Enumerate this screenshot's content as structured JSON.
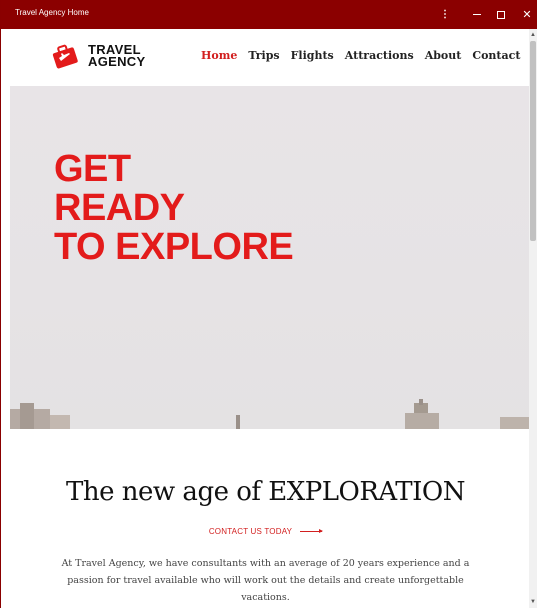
{
  "window": {
    "title": "Travel Agency Home",
    "colors": {
      "titlebar": "#8b0000",
      "accent": "#d21f1f",
      "hero_text": "#e31b1b"
    }
  },
  "header": {
    "logo": {
      "line1": "TRAVEL",
      "line2": "AGENCY",
      "icon": "suitcase-plane-icon"
    },
    "nav": [
      {
        "label": "Home",
        "active": true
      },
      {
        "label": "Trips",
        "active": false
      },
      {
        "label": "Flights",
        "active": false
      },
      {
        "label": "Attractions",
        "active": false
      },
      {
        "label": "About",
        "active": false
      },
      {
        "label": "Contact",
        "active": false
      }
    ]
  },
  "hero": {
    "lines": [
      "GET",
      "READY",
      "TO EXPLORE"
    ]
  },
  "section": {
    "title": "The new age of EXPLORATION",
    "cta": "CONTACT US TODAY",
    "description": "At Travel Agency, we have consultants with an average of 20 years experience and a passion for travel available who will work out the details and create unforgettable vacations."
  }
}
